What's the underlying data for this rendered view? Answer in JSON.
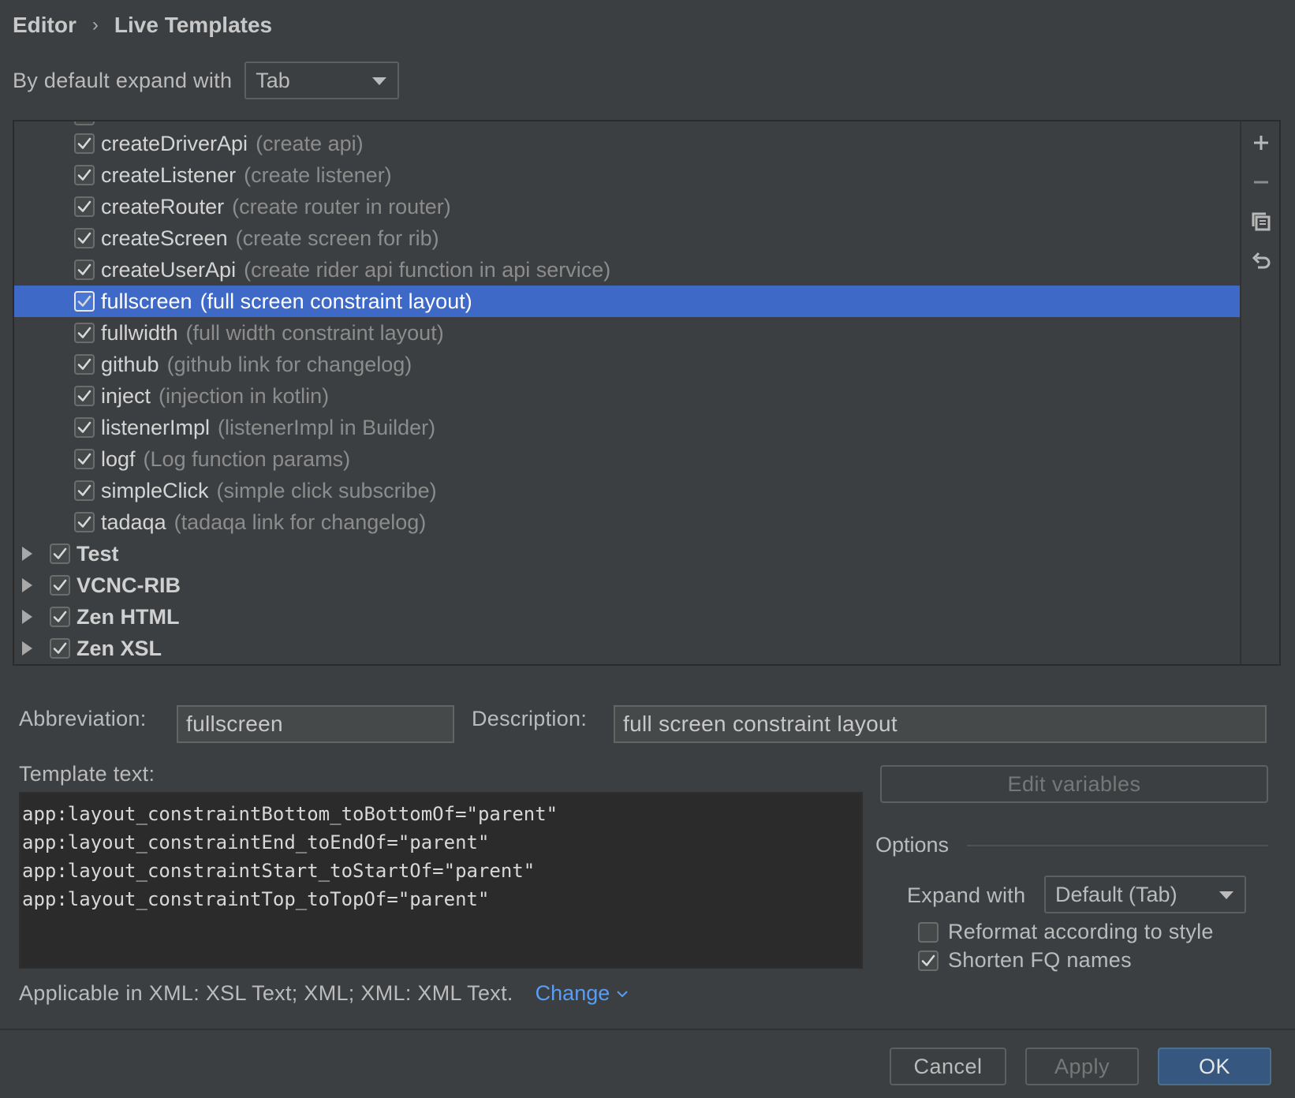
{
  "breadcrumb": {
    "parent": "Editor",
    "separator": "›",
    "current": "Live Templates"
  },
  "expand_default": {
    "label": "By default expand with",
    "value": "Tab"
  },
  "templates": [
    {
      "name": "createDriverApi",
      "desc": "(create api)",
      "checked": true
    },
    {
      "name": "createListener",
      "desc": "(create listener)",
      "checked": true
    },
    {
      "name": "createRouter",
      "desc": "(create router in router)",
      "checked": true
    },
    {
      "name": "createScreen",
      "desc": "(create screen for rib)",
      "checked": true
    },
    {
      "name": "createUserApi",
      "desc": "(create rider api function in api service)",
      "checked": true
    },
    {
      "name": "fullscreen",
      "desc": "(full screen constraint layout)",
      "checked": true,
      "selected": true
    },
    {
      "name": "fullwidth",
      "desc": "(full width constraint layout)",
      "checked": true
    },
    {
      "name": "github",
      "desc": "(github link for changelog)",
      "checked": true
    },
    {
      "name": "inject",
      "desc": "(injection in kotlin)",
      "checked": true
    },
    {
      "name": "listenerImpl",
      "desc": "(listenerImpl in Builder)",
      "checked": true
    },
    {
      "name": "logf",
      "desc": "(Log function params)",
      "checked": true
    },
    {
      "name": "simpleClick",
      "desc": "(simple click subscribe)",
      "checked": true
    },
    {
      "name": "tadaqa",
      "desc": "(tadaqa link for changelog)",
      "checked": true
    }
  ],
  "groups": [
    {
      "name": "Test",
      "checked": true
    },
    {
      "name": "VCNC-RIB",
      "checked": true
    },
    {
      "name": "Zen HTML",
      "checked": true
    },
    {
      "name": "Zen XSL",
      "checked": true
    }
  ],
  "toolbar_icons": [
    "add-icon",
    "remove-icon",
    "copy-icon",
    "restore-icon"
  ],
  "abbreviation": {
    "label": "Abbreviation:",
    "value": "fullscreen"
  },
  "description": {
    "label": "Description:",
    "value": "full screen constraint layout"
  },
  "template_text": {
    "label": "Template text:",
    "lines": [
      "app:layout_constraintBottom_toBottomOf=\"parent\"",
      "app:layout_constraintEnd_toEndOf=\"parent\"",
      "app:layout_constraintStart_toStartOf=\"parent\"",
      "app:layout_constraintTop_toTopOf=\"parent\""
    ]
  },
  "edit_variables_label": "Edit variables",
  "options": {
    "title": "Options",
    "expand_label": "Expand with",
    "expand_value": "Default (Tab)",
    "reformat_label": "Reformat according to style",
    "reformat_checked": false,
    "shorten_label": "Shorten FQ names",
    "shorten_checked": true
  },
  "applicable": {
    "text": "Applicable in XML: XSL Text; XML; XML: XML Text.",
    "link": "Change"
  },
  "footer": {
    "cancel": "Cancel",
    "apply": "Apply",
    "ok": "OK"
  },
  "colors": {
    "background": "#3c3f41",
    "selection": "#3f69c6",
    "link": "#589df6",
    "primary_button": "#365880"
  }
}
